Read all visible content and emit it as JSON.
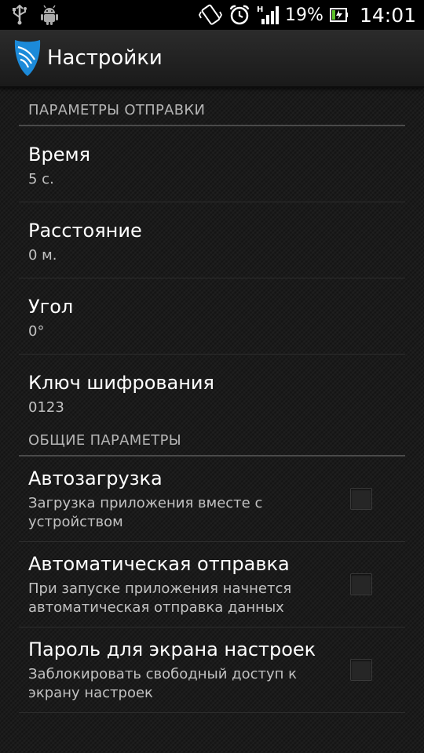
{
  "statusbar": {
    "battery_percent": "19%",
    "time": "14:01",
    "icons": [
      "usb-icon",
      "android-debug-icon",
      "vibrate-icon",
      "alarm-clock-icon",
      "signal-h-icon",
      "battery-charging-icon"
    ]
  },
  "actionbar": {
    "title": "Настройки"
  },
  "sections": {
    "send": {
      "header": "ПАРАМЕТРЫ ОТПРАВКИ",
      "time": {
        "title": "Время",
        "summary": "5 с."
      },
      "distance": {
        "title": "Расстояние",
        "summary": "0 м."
      },
      "angle": {
        "title": "Угол",
        "summary": "0°"
      },
      "key": {
        "title": "Ключ шифрования",
        "summary": "0123"
      }
    },
    "general": {
      "header": "ОБЩИЕ ПАРАМЕТРЫ",
      "autoload": {
        "title": "Автозагрузка",
        "summary": "Загрузка приложения вместе с устройством",
        "checked": false
      },
      "autosend": {
        "title": "Автоматическая отправка",
        "summary": "При запуске приложения начнется автоматическая отправка данных",
        "checked": false
      },
      "password": {
        "title": "Пароль для экрана настроек",
        "summary": "Заблокировать свободный доступ к экрану настроек",
        "checked": false
      }
    }
  }
}
